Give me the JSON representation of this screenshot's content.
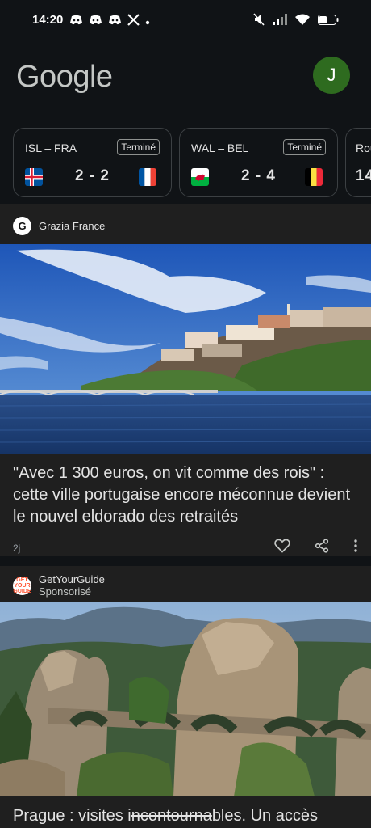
{
  "status_bar": {
    "time": "14:20"
  },
  "header": {
    "logo_text": "Google",
    "avatar_initial": "J"
  },
  "scores": [
    {
      "teams": "ISL – FRA",
      "status": "Terminé",
      "score": "2 - 2"
    },
    {
      "teams": "WAL – BEL",
      "status": "Terminé",
      "score": "2 - 4"
    },
    {
      "teams": "Rou",
      "status": "",
      "score": "14"
    }
  ],
  "articles": [
    {
      "source": "Grazia France",
      "source_logo": "G",
      "headline": "\"Avec 1 300 euros, on vit comme des rois\" : cette ville portugaise encore méconnue devient le nouvel eldorado des retraités",
      "age": "2j"
    },
    {
      "source": "GetYourGuide",
      "sponsored": "Sponsorisé",
      "headline_part1": "Prague : visites i",
      "headline_strike": "ncontourna",
      "headline_part2": "bles. Un accès"
    }
  ],
  "colors": {
    "avatar_bg": "#2e6b1f",
    "background": "#1f1f1f",
    "header_bg": "#101316"
  }
}
